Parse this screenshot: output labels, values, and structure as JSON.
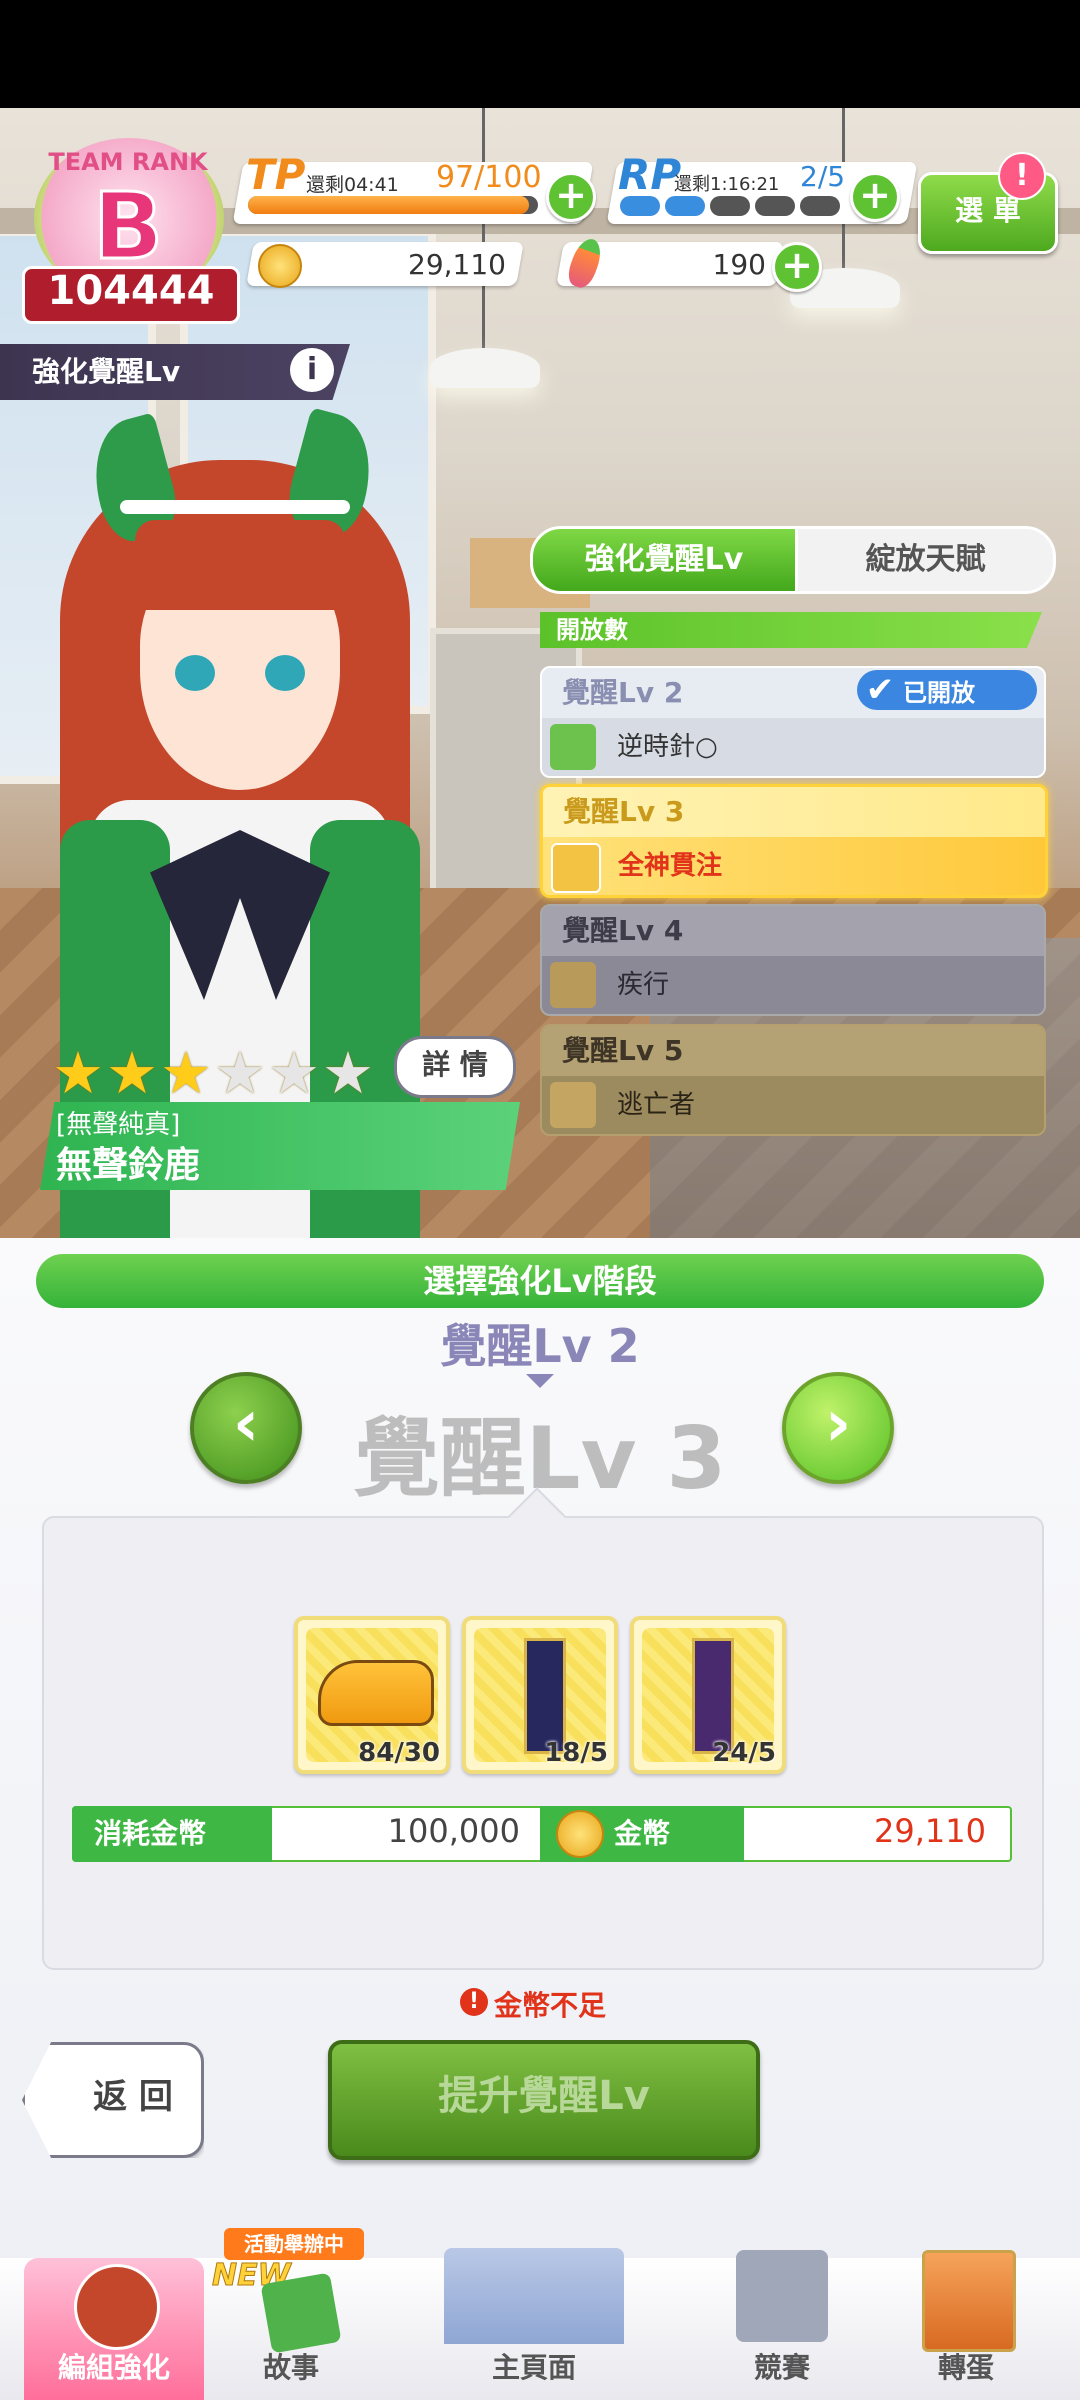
{
  "team_rank": {
    "label": "TEAM RANK",
    "grade": "B",
    "score": "104444"
  },
  "tp": {
    "label": "TP",
    "timer": "還剩04:41",
    "value": "97/100",
    "fill": 0.97
  },
  "rp": {
    "label": "RP",
    "timer": "還剩1:16:21",
    "value": "2/5",
    "filled": 2,
    "total": 5
  },
  "coins": {
    "value": "29,110"
  },
  "carrots": {
    "value": "190"
  },
  "menu": {
    "label": "選 單",
    "badge": "!"
  },
  "page_title": "強化覺醒Lv",
  "info_icon": "i",
  "tabs": {
    "active": "強化覺醒Lv",
    "inactive": "綻放天賦"
  },
  "open_count_label": "開放數",
  "awakening": [
    {
      "level": "覺醒Lv 2",
      "skill": "逆時針○",
      "status": "已開放",
      "state": "opened"
    },
    {
      "level": "覺醒Lv 3",
      "skill": "全神貫注",
      "state": "selected"
    },
    {
      "level": "覺醒Lv 4",
      "skill": "疾行",
      "state": "locked"
    },
    {
      "level": "覺醒Lv 5",
      "skill": "逃亡者",
      "state": "locked"
    }
  ],
  "character": {
    "title": "[無聲純真]",
    "name": "無聲鈴鹿",
    "stars": 3,
    "max_stars": 6,
    "detail_label": "詳 情"
  },
  "select_stage_label": "選擇強化Lv階段",
  "stage": {
    "prev": "覺醒Lv 2",
    "current": "覺醒Lv 3"
  },
  "materials": [
    {
      "icon": "shoes-icon",
      "count": "84/30"
    },
    {
      "icon": "scroll-icon",
      "count": "18/5"
    },
    {
      "icon": "scroll-icon",
      "count": "24/5"
    }
  ],
  "cost": {
    "label": "消耗金幣",
    "value": "100,000",
    "coin_label": "金幣",
    "owned": "29,110"
  },
  "warning": "金幣不足",
  "back_label": "返 回",
  "upgrade_label": "提升覺醒Lv",
  "nav": {
    "items": [
      {
        "label": "編組強化",
        "active": true
      },
      {
        "label": "故事",
        "badge": "活動舉辦中",
        "new": "NEW"
      },
      {
        "label": "主頁面"
      },
      {
        "label": "競賽"
      },
      {
        "label": "轉蛋"
      }
    ]
  },
  "colors": {
    "green": "#5fc233",
    "orange": "#f08b1c",
    "red": "#e0331a",
    "pink": "#ff6e9a"
  }
}
